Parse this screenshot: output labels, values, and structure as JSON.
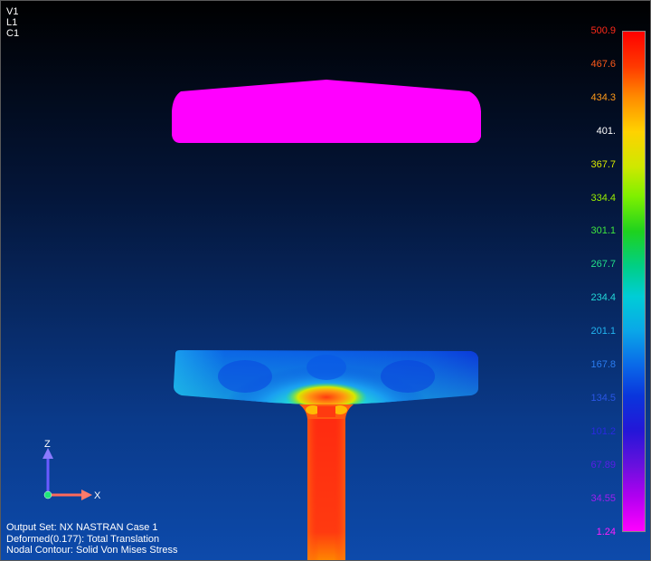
{
  "view_info": [
    "V1",
    "L1",
    "C1"
  ],
  "legend": {
    "values": [
      "500.9",
      "467.6",
      "434.3",
      "401.",
      "367.7",
      "334.4",
      "301.1",
      "267.7",
      "234.4",
      "201.1",
      "167.8",
      "134.5",
      "101.2",
      "67.89",
      "34.55",
      "1.24"
    ],
    "colors": [
      "#ff2a1a",
      "#ff5a1a",
      "#ff9a1a",
      "#ffffff",
      "#d8e800",
      "#9aef00",
      "#3ee63e",
      "#22e08a",
      "#22d8d8",
      "#22b4f0",
      "#2a7cf0",
      "#2a56e6",
      "#2a2ae0",
      "#5a1ee6",
      "#a01ef0",
      "#ff1eff"
    ]
  },
  "footer": {
    "output_set": "Output Set: NX NASTRAN Case 1",
    "deformed": "Deformed(0.177): Total Translation",
    "contour": "Nodal Contour: Solid Von Mises Stress"
  },
  "axes": {
    "z_label": "Z",
    "x_label": "X"
  },
  "colors": {
    "upper_part": "#ff00ff",
    "stem_hot": "#ff3a10",
    "stress_low": "#0a3adc"
  }
}
